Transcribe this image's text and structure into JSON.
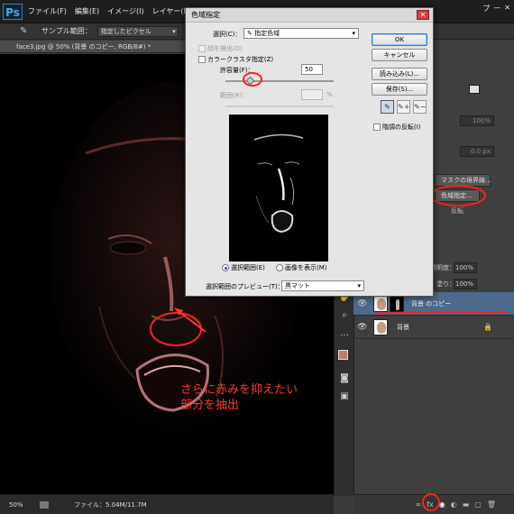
{
  "app": {
    "logo": "Ps",
    "menu": [
      "ファイル(F)",
      "編集(E)",
      "イメージ(I)",
      "レイヤー(L)"
    ],
    "menu_tail": "プ"
  },
  "options_bar": {
    "sample_label": "サンプル範囲：",
    "sample_value": "指定したピクセル"
  },
  "document": {
    "tab_title": "face3.jpg @ 50% (背景 のコピー, RGB/8#) *",
    "zoom": "50%",
    "file_size": "ファイル：5.04M/11.7M"
  },
  "annotation": {
    "line1": "さらに赤みを抑えたい",
    "line2": "部分を抽出",
    "color": "#ff3a2a"
  },
  "dialog": {
    "title": "色域指定",
    "select_label": "選択(C)：",
    "select_value": "指定色域",
    "detect_faces": "顔を検出(D)",
    "localized_clusters": "カラークラスタ指定(Z)",
    "fuzziness_label": "許容量(F)：",
    "fuzziness_value": "50",
    "fuzziness_fraction": 0.23,
    "range_label": "範囲(R)：",
    "range_unit": "%",
    "radio_selection": "選択範囲(E)",
    "radio_image": "画像を表示(M)",
    "preview_label": "選択範囲のプレビュー(T)：",
    "preview_value": "黒マット",
    "ok": "OK",
    "cancel": "キャンセル",
    "load": "読み込み(L)...",
    "save": "保存(S)...",
    "invert": "階調の反転(I)"
  },
  "properties_panel": {
    "mask_edge": "マスクの境界線...",
    "color_range": "色域指定...",
    "invert": "反転",
    "density": "100%",
    "feather": "0.0 px"
  },
  "layers_panel": {
    "opacity_label": "不透明度：",
    "opacity_value": "100%",
    "fill_label": "塗り：",
    "fill_value": "100%",
    "layers": [
      {
        "name": "背景 のコピー",
        "selected": true
      },
      {
        "name": "背景",
        "selected": false
      }
    ],
    "bottom_icons": [
      "link-icon",
      "fx-icon",
      "mask-icon",
      "adjustment-icon",
      "folder-icon",
      "new-layer-icon",
      "trash-icon"
    ]
  },
  "colors": {
    "foreground": "#c47b74",
    "background": "#ffffff",
    "highlight": "#ff2020",
    "selected_layer": "#4d6a8c"
  }
}
